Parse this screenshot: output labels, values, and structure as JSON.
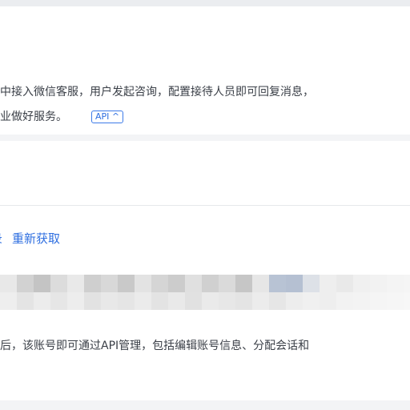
{
  "description": {
    "line1": "中接入微信客服，用户发起咨询，配置接待人员即可回复消息，",
    "line2": "业做好服务。",
    "api_tag": "API ^"
  },
  "actions": {
    "left_fragment": "录",
    "refresh_link": "重新获取"
  },
  "masked_content": {
    "description": "pixelated / blurred content (redacted)"
  },
  "note": "后，该账号即可通过API管理，包括编辑账号信息、分配会话和",
  "colors": {
    "link": "#2f6fe0",
    "text": "#3a3f47",
    "page_bg": "#f3f4f6",
    "card_bg": "#ffffff"
  }
}
